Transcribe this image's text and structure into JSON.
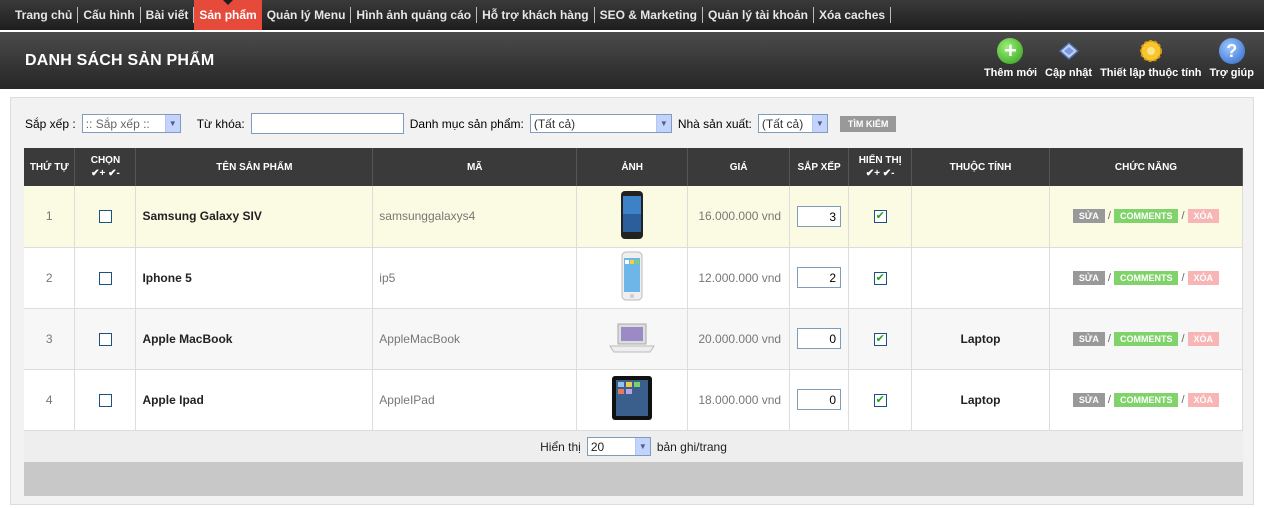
{
  "topnav": {
    "items": [
      "Trang chủ",
      "Cấu hình",
      "Bài viết",
      "Sản phẩm",
      "Quản lý Menu",
      "Hình ảnh quảng cáo",
      "Hỗ trợ khách hàng",
      "SEO & Marketing",
      "Quản lý tài khoản",
      "Xóa caches"
    ],
    "active_index": 3
  },
  "header": {
    "title": "DANH SÁCH SẢN PHẨM",
    "tools": {
      "add": "Thêm mới",
      "update": "Cập nhật",
      "attr": "Thiết lập thuộc tính",
      "help": "Trợ giúp"
    }
  },
  "filters": {
    "sort_label": "Sắp xếp :",
    "sort_value": ":: Sắp xếp ::",
    "keyword_label": "Từ khóa:",
    "keyword_value": "",
    "category_label": "Danh mục sản phẩm:",
    "category_value": "(Tất cả)",
    "maker_label": "Nhà sản xuất:",
    "maker_value": "(Tất cả)",
    "search_button": "TÌM KIẾM"
  },
  "table": {
    "headers": {
      "order": "THỨ TỰ",
      "select": "CHỌN",
      "name": "TÊN SẢN PHẨM",
      "code": "MÃ",
      "image": "ẢNH",
      "price": "GIÁ",
      "sort": "SẮP XẾP",
      "visible": "HIỂN THỊ",
      "attribute": "THUỘC TÍNH",
      "functions": "CHỨC NĂNG"
    },
    "rows": [
      {
        "order": "1",
        "name": "Samsung Galaxy SIV",
        "code": "samsunggalaxys4",
        "price": "16.000.000  vnd",
        "sort": "3",
        "attribute": "",
        "image": "phone-dark"
      },
      {
        "order": "2",
        "name": "Iphone 5",
        "code": "ip5",
        "price": "12.000.000  vnd",
        "sort": "2",
        "attribute": "",
        "image": "phone-white"
      },
      {
        "order": "3",
        "name": "Apple MacBook",
        "code": "AppleMacBook",
        "price": "20.000.000  vnd",
        "sort": "0",
        "attribute": "Laptop",
        "image": "laptop"
      },
      {
        "order": "4",
        "name": "Apple Ipad",
        "code": "AppleIPad",
        "price": "18.000.000  vnd",
        "sort": "0",
        "attribute": "Laptop",
        "image": "tablet"
      }
    ],
    "actions": {
      "edit": "SỬA",
      "comments": "COMMENTS",
      "delete": "XÓA",
      "sep": "/"
    }
  },
  "pager": {
    "label_before": "Hiển thị",
    "per_page": "20",
    "label_after": "bản ghi/trang"
  },
  "colors": {
    "active_nav": "#e64a3b",
    "edit_btn": "#999999",
    "comments_btn": "#7fd36a",
    "delete_btn": "#f8b5b5"
  }
}
